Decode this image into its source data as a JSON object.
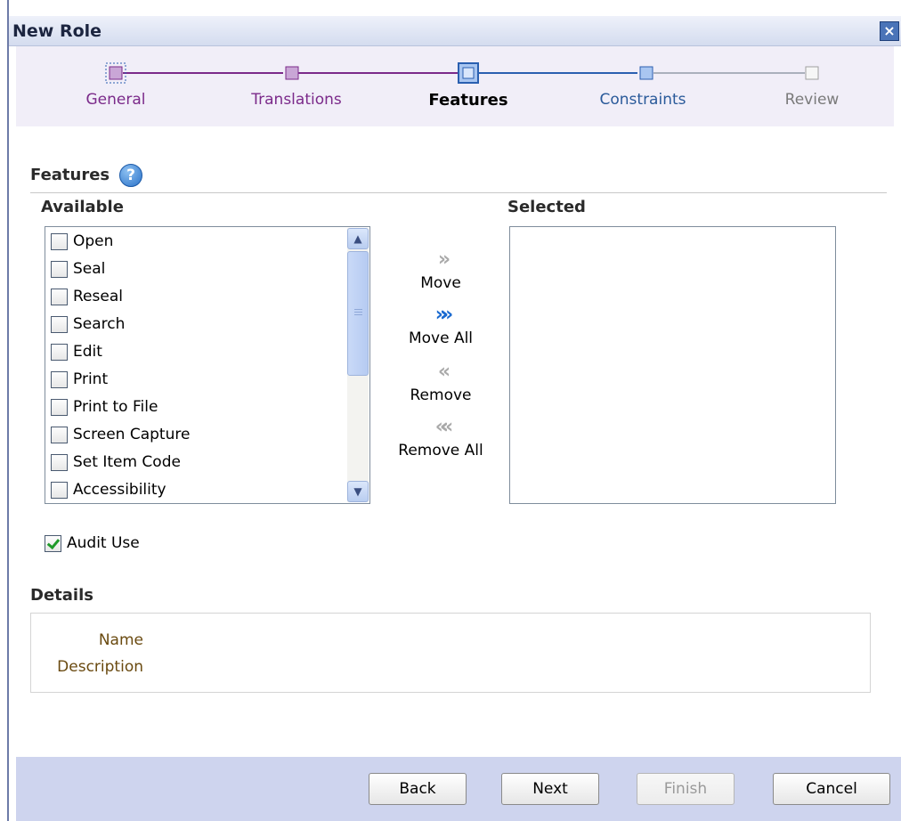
{
  "dialog": {
    "title": "New Role",
    "close_symbol": "×"
  },
  "train": {
    "steps": [
      {
        "label": "General",
        "state": "visited",
        "color": "#7b2a8a"
      },
      {
        "label": "Translations",
        "state": "visited",
        "color": "#7b2a8a"
      },
      {
        "label": "Features",
        "state": "current",
        "color": "#000000"
      },
      {
        "label": "Constraints",
        "state": "unvisited",
        "color": "#2a5a9a"
      },
      {
        "label": "Review",
        "state": "disabled",
        "color": "#7a7a7a"
      }
    ]
  },
  "features": {
    "title": "Features",
    "help_symbol": "?",
    "available_label": "Available",
    "selected_label": "Selected",
    "available_options": [
      {
        "label": "Open",
        "checked": false
      },
      {
        "label": "Seal",
        "checked": false
      },
      {
        "label": "Reseal",
        "checked": false
      },
      {
        "label": "Search",
        "checked": false
      },
      {
        "label": "Edit",
        "checked": false
      },
      {
        "label": "Print",
        "checked": false
      },
      {
        "label": "Print to File",
        "checked": false
      },
      {
        "label": "Screen Capture",
        "checked": false
      },
      {
        "label": "Set Item Code",
        "checked": false
      },
      {
        "label": "Accessibility",
        "checked": false
      }
    ],
    "selected_options": [],
    "shuttle": {
      "move": "Move",
      "move_all": "Move All",
      "remove": "Remove",
      "remove_all": "Remove All"
    },
    "audit_use": {
      "label": "Audit Use",
      "checked": true
    }
  },
  "details": {
    "title": "Details",
    "name_label": "Name",
    "description_label": "Description"
  },
  "footer": {
    "back": "Back",
    "next": "Next",
    "finish": "Finish",
    "cancel": "Cancel"
  },
  "colors": {
    "train_background": "#f1eef8",
    "visited_purple": "#7b2a8a",
    "current_blue": "#2a5fb0",
    "footer_background": "#ced4ee"
  }
}
